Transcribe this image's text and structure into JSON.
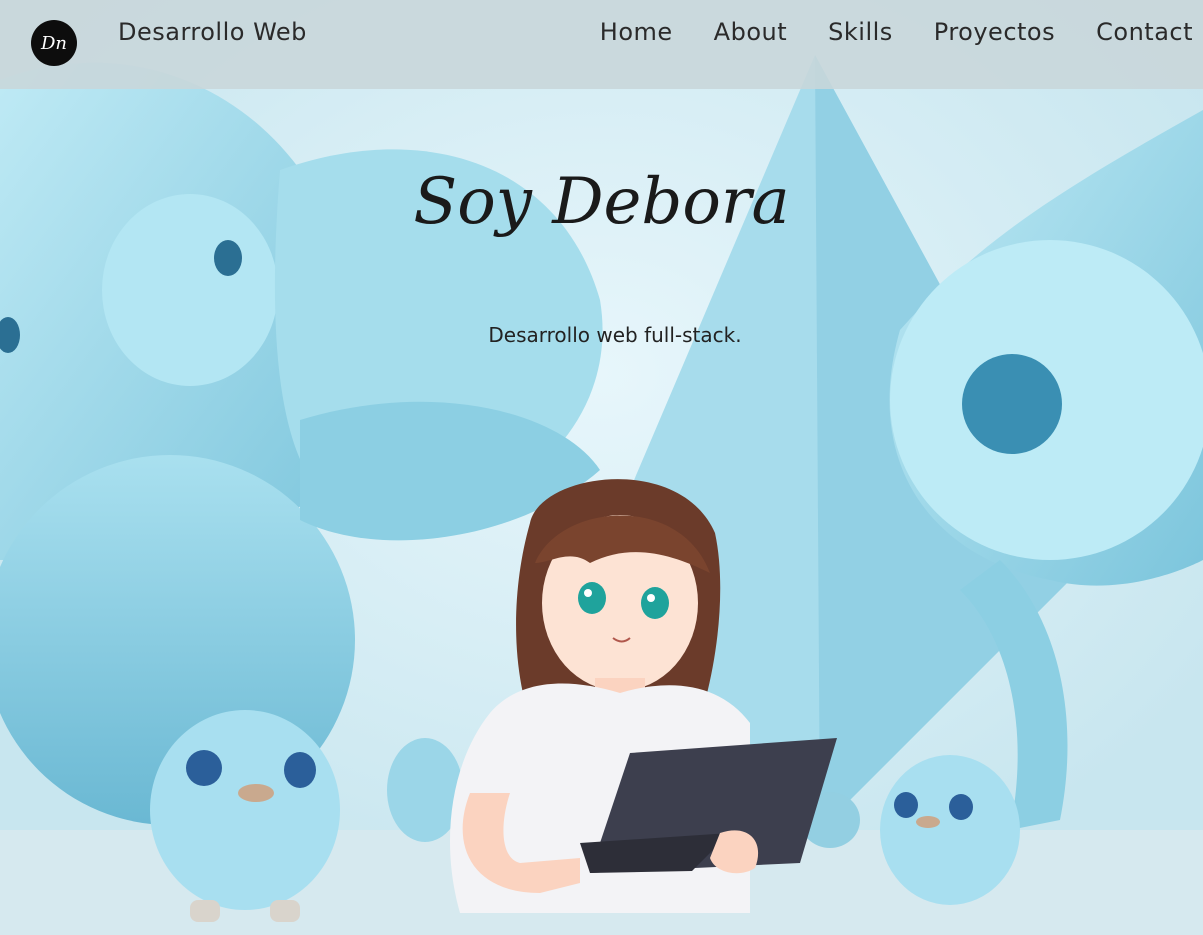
{
  "header": {
    "logo_text": "Dn",
    "brand": "Desarrollo Web",
    "nav": [
      "Home",
      "About",
      "Skills",
      "Proyectos",
      "Contact"
    ]
  },
  "hero": {
    "title": "Soy Debora",
    "subtitle": "Desarrollo web full-stack."
  },
  "colors": {
    "accent_blue": "#8fd3e8",
    "navbar": "#c8d6da",
    "logo_bg": "#0d0d0d"
  }
}
